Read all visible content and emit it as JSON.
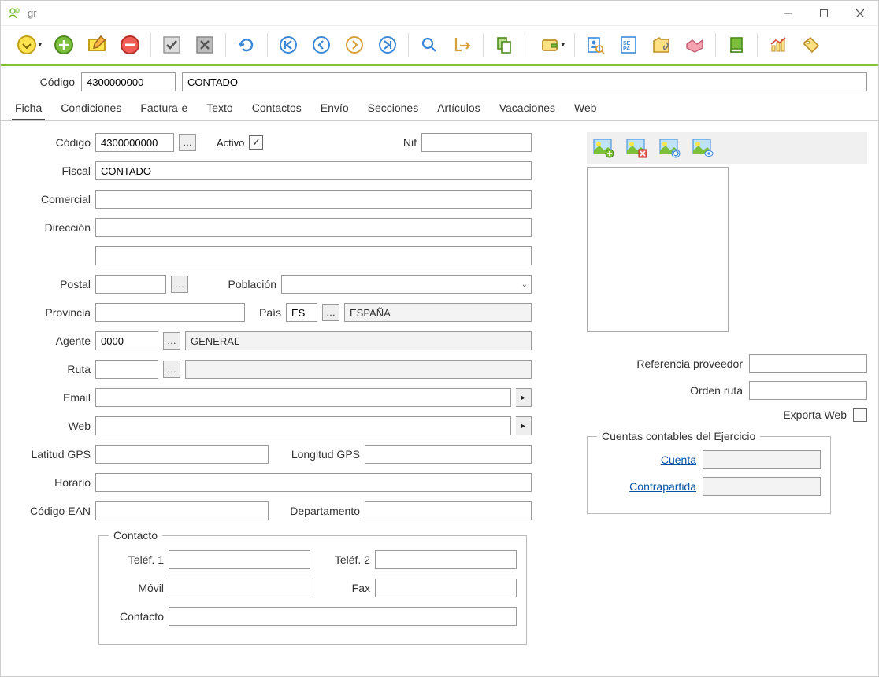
{
  "window": {
    "title": "gr"
  },
  "header": {
    "codigo_label": "Código",
    "codigo_value": "4300000000",
    "name_value": "CONTADO"
  },
  "tabs": [
    "Ficha",
    "Condiciones",
    "Factura-e",
    "Texto",
    "Contactos",
    "Envío",
    "Secciones",
    "Artículos",
    "Vacaciones",
    "Web"
  ],
  "tabs_underline_chars": [
    "F",
    "n",
    "",
    "x",
    "C",
    "E",
    "S",
    "",
    "V",
    ""
  ],
  "form": {
    "codigo_label": "Código",
    "codigo_value": "4300000000",
    "activo_label": "Activo",
    "activo_checked": true,
    "nif_label": "Nif",
    "nif_value": "",
    "fiscal_label": "Fiscal",
    "fiscal_value": "CONTADO",
    "comercial_label": "Comercial",
    "comercial_value": "",
    "direccion_label": "Dirección",
    "direccion_value": "",
    "direccion2_value": "",
    "postal_label": "Postal",
    "postal_value": "",
    "poblacion_label": "Población",
    "poblacion_value": "",
    "provincia_label": "Provincia",
    "provincia_value": "",
    "pais_label": "País",
    "pais_code": "ES",
    "pais_name": "ESPAÑA",
    "agente_label": "Agente",
    "agente_code": "0000",
    "agente_name": "GENERAL",
    "ruta_label": "Ruta",
    "ruta_code": "",
    "ruta_name": "",
    "email_label": "Email",
    "email_value": "",
    "web_label": "Web",
    "web_value": "",
    "lat_label": "Latitud GPS",
    "lat_value": "",
    "lon_label": "Longitud GPS",
    "lon_value": "",
    "horario_label": "Horario",
    "horario_value": "",
    "ean_label": "Código EAN",
    "ean_value": "",
    "departamento_label": "Departamento",
    "departamento_value": ""
  },
  "contacto": {
    "legend": "Contacto",
    "telef1_label": "Teléf. 1",
    "telef1_value": "",
    "telef2_label": "Teléf. 2",
    "telef2_value": "",
    "movil_label": "Móvil",
    "movil_value": "",
    "fax_label": "Fax",
    "fax_value": "",
    "contacto_label": "Contacto",
    "contacto_value": ""
  },
  "right": {
    "ref_prov_label": "Referencia proveedor",
    "ref_prov_value": "",
    "orden_ruta_label": "Orden ruta",
    "orden_ruta_value": "",
    "exporta_web_label": "Exporta Web",
    "exporta_web_checked": false,
    "accounts_legend": "Cuentas contables del Ejercicio",
    "cuenta_label": "Cuenta",
    "cuenta_value": "",
    "contrapartida_label": "Contrapartida",
    "contrapartida_value": ""
  }
}
